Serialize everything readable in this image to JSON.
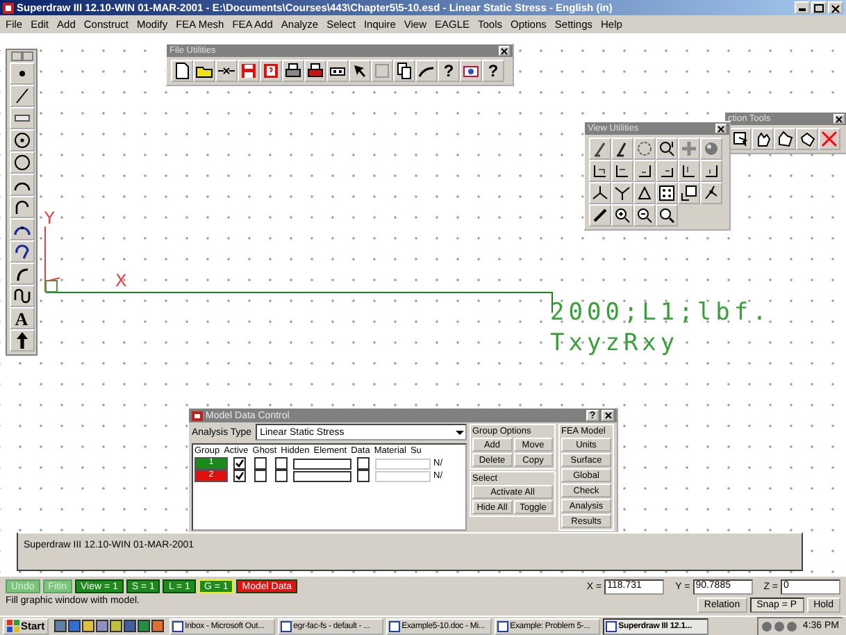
{
  "window": {
    "title": "Superdraw III 12.10-WIN 01-MAR-2001 - E:\\Documents\\Courses\\443\\Chapter5\\5-10.esd - Linear Static Stress - English (in)"
  },
  "menu": [
    "File",
    "Edit",
    "Add",
    "Construct",
    "Modify",
    "FEA Mesh",
    "FEA Add",
    "Analyze",
    "Select",
    "Inquire",
    "View",
    "EAGLE",
    "Tools",
    "Options",
    "Settings",
    "Help"
  ],
  "toolbox": {
    "text_tool_glyph": "A"
  },
  "file_utilities": {
    "title": "File Utilities",
    "context_help_glyph": "?",
    "help_glyph": "?"
  },
  "view_utilities": {
    "title": "View Utilities"
  },
  "selection_tools": {
    "title": "ction Tools"
  },
  "canvas": {
    "axis_labels": [
      "Y",
      "X"
    ],
    "load_label": [
      "2000;L1;lbf.",
      "TxyzRxy"
    ]
  },
  "model_data_control": {
    "title": "Model Data Control",
    "help_glyph": "?",
    "analysis_type_label": "Analysis Type",
    "analysis_type": "Linear Static Stress",
    "columns": [
      "Group",
      "Active",
      "Ghost",
      "Hidden",
      "Element",
      "Data",
      "Material",
      "Su"
    ],
    "rows": [
      {
        "group": "1",
        "color": "#1a8a1a",
        "active": true,
        "ghost": false,
        "hidden": false,
        "data": false,
        "su": "N/"
      },
      {
        "group": "2",
        "color": "#e01010",
        "active": true,
        "ghost": false,
        "hidden": false,
        "data": false,
        "su": "N/"
      }
    ],
    "group_options_title": "Group Options",
    "group_options": [
      "Add",
      "Move",
      "Delete",
      "Copy"
    ],
    "select_title": "Select",
    "select_buttons": [
      "Activate All",
      "Hide All",
      "Toggle"
    ],
    "fea_model_title": "FEA Model",
    "fea_model_buttons": [
      "Units",
      "Surface",
      "Global",
      "Check",
      "Analysis",
      "Results"
    ]
  },
  "output_window": {
    "text": "Superdraw III 12.10-WIN 01-MAR-2001"
  },
  "command_buttons": [
    {
      "label": "Undo",
      "color": "#7cc47c",
      "disabled": true,
      "selected": false
    },
    {
      "label": "Fitin",
      "color": "#7cc47c",
      "disabled": true,
      "selected": false
    },
    {
      "label": "View = 1",
      "color": "#1e8a1e",
      "disabled": false,
      "selected": false
    },
    {
      "label": "S = 1",
      "color": "#1e8a1e",
      "disabled": false,
      "selected": false
    },
    {
      "label": "L = 1",
      "color": "#1e8a1e",
      "disabled": false,
      "selected": false
    },
    {
      "label": "G = 1",
      "color": "#1e8a1e",
      "disabled": false,
      "selected": true
    },
    {
      "label": "Model Data",
      "color": "#e01414",
      "disabled": false,
      "selected": false
    }
  ],
  "coordinates": [
    {
      "label": "X =",
      "value": "118.731"
    },
    {
      "label": "Y =",
      "value": "90.7885"
    },
    {
      "label": "Z =",
      "value": "0"
    }
  ],
  "mode_buttons": [
    {
      "label": "Relation",
      "selected": false
    },
    {
      "label": "Snap = P",
      "selected": true
    },
    {
      "label": "Hold",
      "selected": false
    }
  ],
  "status_text": "Fill graphic window with model.",
  "taskbar": {
    "start": "Start",
    "tasks": [
      {
        "label": "Inbox - Microsoft Out...",
        "selected": false
      },
      {
        "label": "egr-fac-fs - default - ...",
        "selected": false
      },
      {
        "label": "Example5-10.doc - Mi...",
        "selected": false
      },
      {
        "label": "Example: Problem 5-...",
        "selected": false
      },
      {
        "label": "Superdraw III 12.1...",
        "selected": true
      }
    ],
    "clock": "4:36 PM"
  }
}
